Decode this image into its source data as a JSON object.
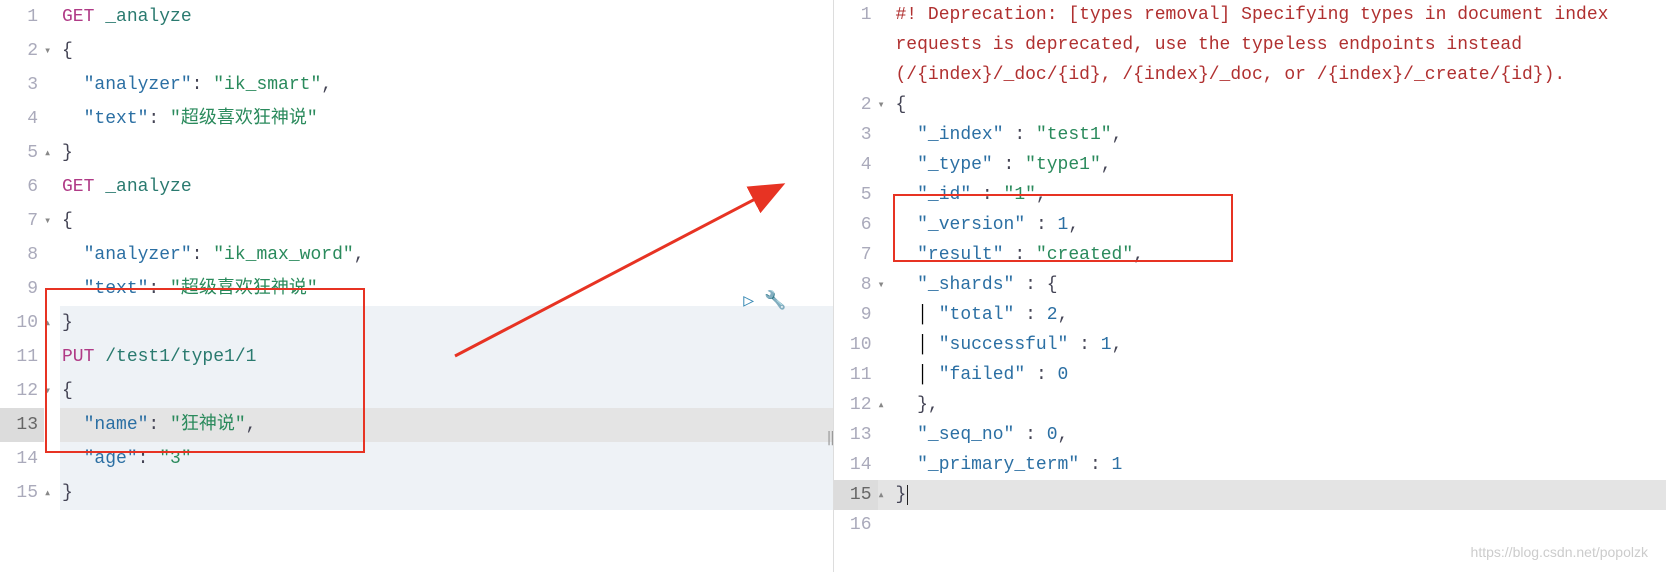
{
  "left": {
    "lines": [
      {
        "n": 1,
        "fold": "",
        "tokens": [
          [
            "method",
            "GET"
          ],
          [
            "text",
            " "
          ],
          [
            "path",
            "_analyze"
          ]
        ]
      },
      {
        "n": 2,
        "fold": "▾",
        "tokens": [
          [
            "punct",
            "{"
          ]
        ]
      },
      {
        "n": 3,
        "fold": "",
        "tokens": [
          [
            "text",
            "  "
          ],
          [
            "key",
            "\"analyzer\""
          ],
          [
            "punct",
            ": "
          ],
          [
            "string",
            "\"ik_smart\""
          ],
          [
            "punct",
            ","
          ]
        ]
      },
      {
        "n": 4,
        "fold": "",
        "tokens": [
          [
            "text",
            "  "
          ],
          [
            "key",
            "\"text\""
          ],
          [
            "punct",
            ": "
          ],
          [
            "string",
            "\"超级喜欢狂神说\""
          ]
        ]
      },
      {
        "n": 5,
        "fold": "▴",
        "tokens": [
          [
            "punct",
            "}"
          ]
        ]
      },
      {
        "n": 6,
        "fold": "",
        "tokens": [
          [
            "method",
            "GET"
          ],
          [
            "text",
            " "
          ],
          [
            "path",
            "_analyze"
          ]
        ]
      },
      {
        "n": 7,
        "fold": "▾",
        "tokens": [
          [
            "punct",
            "{"
          ]
        ]
      },
      {
        "n": 8,
        "fold": "",
        "tokens": [
          [
            "text",
            "  "
          ],
          [
            "key",
            "\"analyzer\""
          ],
          [
            "punct",
            ": "
          ],
          [
            "string",
            "\"ik_max_word\""
          ],
          [
            "punct",
            ","
          ]
        ]
      },
      {
        "n": 9,
        "fold": "",
        "tokens": [
          [
            "text",
            "  "
          ],
          [
            "key",
            "\"text\""
          ],
          [
            "punct",
            ": "
          ],
          [
            "string",
            "\"超级喜欢狂神说\""
          ]
        ]
      },
      {
        "n": 10,
        "fold": "▴",
        "tokens": [
          [
            "punct",
            "}"
          ]
        ],
        "selected": true
      },
      {
        "n": 11,
        "fold": "",
        "tokens": [
          [
            "method",
            "PUT"
          ],
          [
            "text",
            " "
          ],
          [
            "path",
            "/test1/type1/1"
          ]
        ],
        "selected": true
      },
      {
        "n": 12,
        "fold": "▾",
        "tokens": [
          [
            "punct",
            "{"
          ]
        ],
        "selected": true
      },
      {
        "n": 13,
        "fold": "",
        "tokens": [
          [
            "text",
            "  "
          ],
          [
            "key",
            "\"name\""
          ],
          [
            "punct",
            ": "
          ],
          [
            "string",
            "\"狂神说\""
          ],
          [
            "punct",
            ","
          ]
        ],
        "active": true
      },
      {
        "n": 14,
        "fold": "",
        "tokens": [
          [
            "text",
            "  "
          ],
          [
            "key",
            "\"age\""
          ],
          [
            "punct",
            ": "
          ],
          [
            "string",
            "\"3\""
          ]
        ],
        "selected": true
      },
      {
        "n": 15,
        "fold": "▴",
        "tokens": [
          [
            "punct",
            "}"
          ]
        ],
        "selected": true
      }
    ],
    "actions": {
      "runLabel": "▷",
      "wrenchLabel": "🔧"
    }
  },
  "right": {
    "deprecation": "#! Deprecation: [types removal] Specifying types in document index requests is deprecated, use the typeless endpoints instead (/{index}/_doc/{id}, /{index}/_doc, or /{index}/_create/{id}).",
    "lines": [
      {
        "n": 1,
        "fold": "",
        "deprecation": true
      },
      {
        "n": 2,
        "fold": "▾",
        "tokens": [
          [
            "punct",
            "{"
          ]
        ]
      },
      {
        "n": 3,
        "fold": "",
        "tokens": [
          [
            "text",
            "  "
          ],
          [
            "key",
            "\"_index\""
          ],
          [
            "punct",
            " : "
          ],
          [
            "string",
            "\"test1\""
          ],
          [
            "punct",
            ","
          ]
        ]
      },
      {
        "n": 4,
        "fold": "",
        "tokens": [
          [
            "text",
            "  "
          ],
          [
            "key",
            "\"_type\""
          ],
          [
            "punct",
            " : "
          ],
          [
            "string",
            "\"type1\""
          ],
          [
            "punct",
            ","
          ]
        ]
      },
      {
        "n": 5,
        "fold": "",
        "tokens": [
          [
            "text",
            "  "
          ],
          [
            "key",
            "\"_id\""
          ],
          [
            "punct",
            " : "
          ],
          [
            "string",
            "\"1\""
          ],
          [
            "punct",
            ","
          ]
        ]
      },
      {
        "n": 6,
        "fold": "",
        "tokens": [
          [
            "text",
            "  "
          ],
          [
            "key",
            "\"_version\""
          ],
          [
            "punct",
            " : "
          ],
          [
            "num",
            "1"
          ],
          [
            "punct",
            ","
          ]
        ]
      },
      {
        "n": 7,
        "fold": "",
        "tokens": [
          [
            "text",
            "  "
          ],
          [
            "key",
            "\"result\""
          ],
          [
            "punct",
            " : "
          ],
          [
            "string",
            "\"created\""
          ],
          [
            "punct",
            ","
          ]
        ]
      },
      {
        "n": 8,
        "fold": "▾",
        "tokens": [
          [
            "text",
            "  "
          ],
          [
            "key",
            "\"_shards\""
          ],
          [
            "punct",
            " : {"
          ]
        ]
      },
      {
        "n": 9,
        "fold": "",
        "tokens": [
          [
            "text",
            "  "
          ],
          [
            "indent-guide",
            "│ "
          ],
          [
            "key",
            "\"total\""
          ],
          [
            "punct",
            " : "
          ],
          [
            "num",
            "2"
          ],
          [
            "punct",
            ","
          ]
        ]
      },
      {
        "n": 10,
        "fold": "",
        "tokens": [
          [
            "text",
            "  "
          ],
          [
            "indent-guide",
            "│ "
          ],
          [
            "key",
            "\"successful\""
          ],
          [
            "punct",
            " : "
          ],
          [
            "num",
            "1"
          ],
          [
            "punct",
            ","
          ]
        ]
      },
      {
        "n": 11,
        "fold": "",
        "tokens": [
          [
            "text",
            "  "
          ],
          [
            "indent-guide",
            "│ "
          ],
          [
            "key",
            "\"failed\""
          ],
          [
            "punct",
            " : "
          ],
          [
            "num",
            "0"
          ]
        ]
      },
      {
        "n": 12,
        "fold": "▴",
        "tokens": [
          [
            "text",
            "  "
          ],
          [
            "punct",
            "},"
          ]
        ]
      },
      {
        "n": 13,
        "fold": "",
        "tokens": [
          [
            "text",
            "  "
          ],
          [
            "key",
            "\"_seq_no\""
          ],
          [
            "punct",
            " : "
          ],
          [
            "num",
            "0"
          ],
          [
            "punct",
            ","
          ]
        ]
      },
      {
        "n": 14,
        "fold": "",
        "tokens": [
          [
            "text",
            "  "
          ],
          [
            "key",
            "\"_primary_term\""
          ],
          [
            "punct",
            " : "
          ],
          [
            "num",
            "1"
          ]
        ]
      },
      {
        "n": 15,
        "fold": "▴",
        "tokens": [
          [
            "punct",
            "}"
          ]
        ],
        "active": true,
        "cursor": true
      },
      {
        "n": 16,
        "fold": "",
        "tokens": []
      }
    ]
  },
  "watermark": "https://blog.csdn.net/popolzk",
  "colors": {
    "highlight": "#e73323"
  }
}
